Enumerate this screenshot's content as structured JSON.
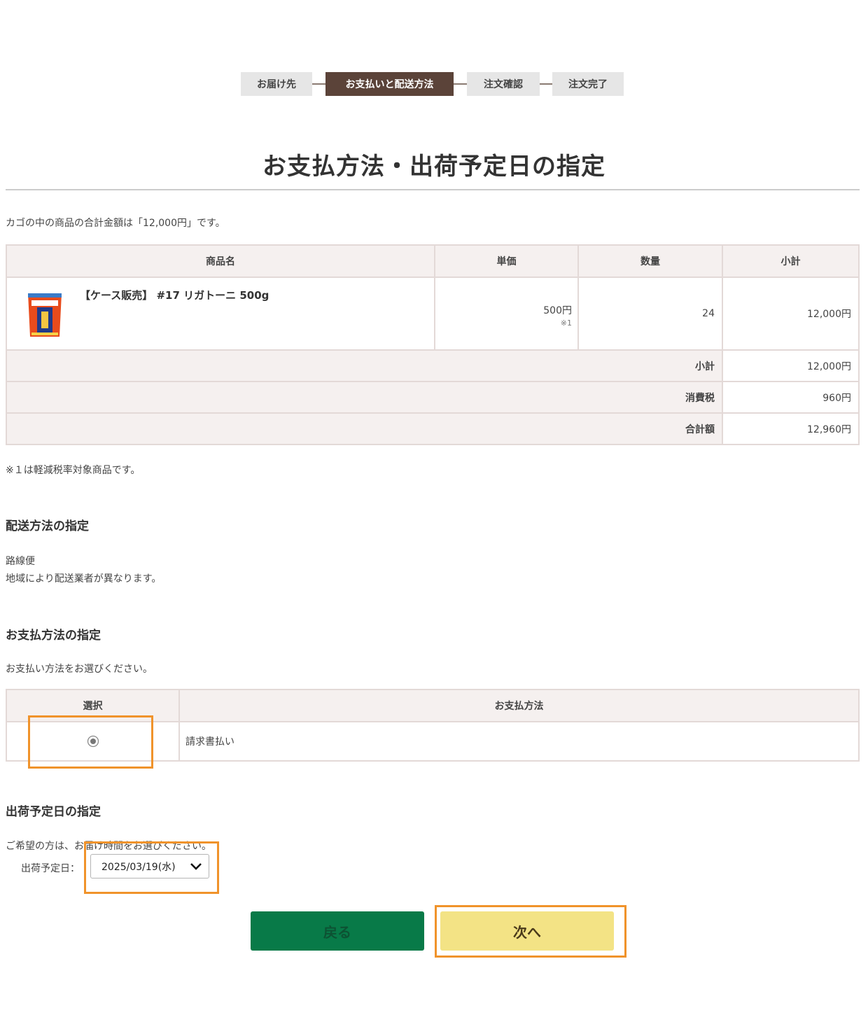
{
  "steps": [
    {
      "label": "お届け先"
    },
    {
      "label": "お支払いと配送方法"
    },
    {
      "label": "注文確認"
    },
    {
      "label": "注文完了"
    }
  ],
  "page_title": "お支払方法・出荷予定日の指定",
  "cart_total_text": "カゴの中の商品の合計金額は「12,000円」です。",
  "cart_table": {
    "headers": [
      "商品名",
      "単価",
      "数量",
      "小計"
    ],
    "item": {
      "name": "【ケース販売】 #17 リガトーニ 500g",
      "unit_price": "500円",
      "tax_note": "※1",
      "quantity": "24",
      "subtotal": "12,000円"
    },
    "summary": [
      {
        "label": "小計",
        "value": "12,000円"
      },
      {
        "label": "消費税",
        "value": "960円"
      },
      {
        "label": "合計額",
        "value": "12,960円"
      }
    ]
  },
  "tax_footnote": "※１は軽減税率対象商品です。",
  "shipping": {
    "heading": "配送方法の指定",
    "method": "路線便",
    "note": "地域により配送業者が異なります。"
  },
  "payment": {
    "heading": "お支払方法の指定",
    "instruction": "お支払い方法をお選びください。",
    "headers": [
      "選択",
      "お支払方法"
    ],
    "option": "請求書払い"
  },
  "ship_date": {
    "heading": "出荷予定日の指定",
    "instruction": "ご希望の方は、お届け時間をお選びください。",
    "label": "出荷予定日：",
    "selected": "2025/03/19(水)"
  },
  "buttons": {
    "back": "戻る",
    "next": "次へ"
  },
  "colors": {
    "step_active": "#5b4339",
    "back_button": "#087a48",
    "next_button": "#f3e385",
    "highlight": "#f0932b"
  }
}
